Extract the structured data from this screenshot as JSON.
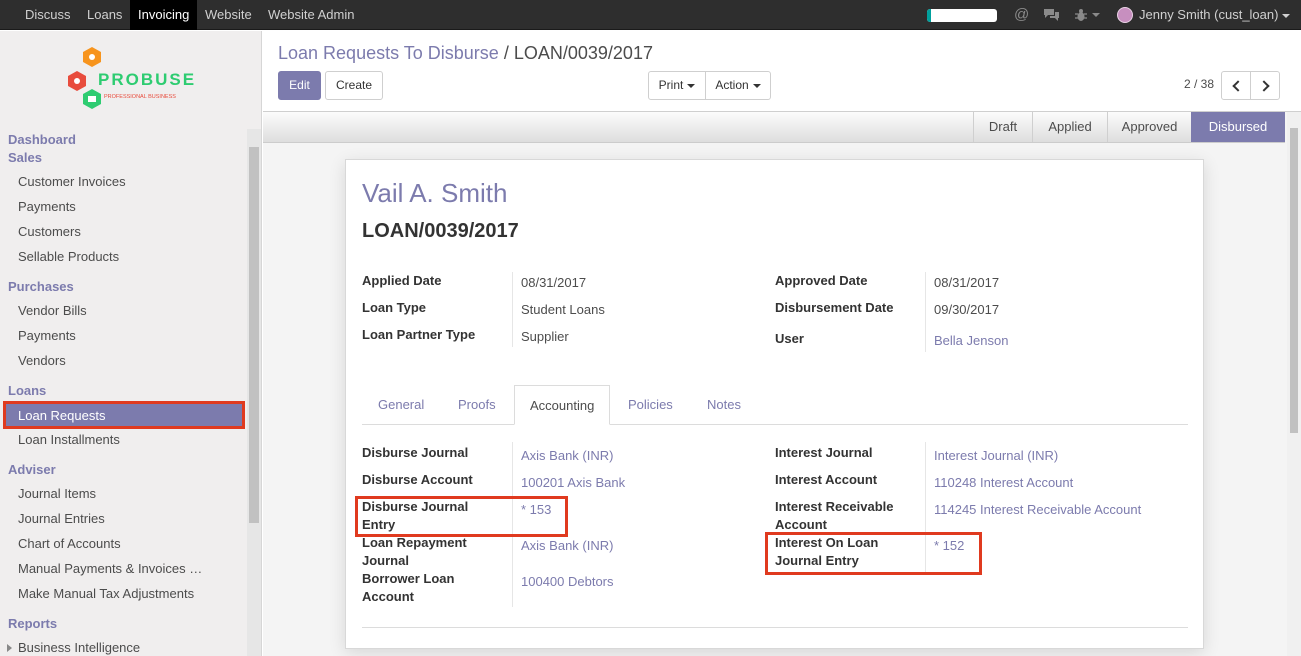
{
  "topbar": {
    "menus": [
      "Discuss",
      "Loans",
      "Invoicing",
      "Website",
      "Website Admin"
    ],
    "active_menu": "Invoicing",
    "progress_fraction": 0.05,
    "user_name": "Jenny Smith (cust_loan)",
    "icons": [
      "at-icon",
      "chat-icon",
      "bug-icon"
    ]
  },
  "logo": {
    "brand": "PROBUSE",
    "tagline": "PROFESSIONAL BUSINESS"
  },
  "sidebar": {
    "dashboard": "Dashboard",
    "sales": "Sales",
    "customer_invoices": "Customer Invoices",
    "payments": "Payments",
    "customers": "Customers",
    "sellable_products": "Sellable Products",
    "purchases": "Purchases",
    "vendor_bills": "Vendor Bills",
    "payments2": "Payments",
    "vendors": "Vendors",
    "loans": "Loans",
    "loan_requests": "Loan Requests",
    "loan_installments": "Loan Installments",
    "adviser": "Adviser",
    "journal_items": "Journal Items",
    "journal_entries": "Journal Entries",
    "chart_of_accounts": "Chart of Accounts",
    "manual_payments": "Manual Payments & Invoices …",
    "manual_tax": "Make Manual Tax Adjustments",
    "reports": "Reports",
    "business_intelligence": "Business Intelligence"
  },
  "breadcrumb": {
    "parent": "Loan Requests To Disburse",
    "separator": "/",
    "current": "LOAN/0039/2017"
  },
  "buttons": {
    "edit": "Edit",
    "create": "Create",
    "print": "Print",
    "action": "Action"
  },
  "pager": {
    "value": "2 / 38"
  },
  "statusbar": {
    "stages": [
      "Draft",
      "Applied",
      "Approved",
      "Disbursed"
    ],
    "active": "Disbursed"
  },
  "record": {
    "partner": "Vail A. Smith",
    "name": "LOAN/0039/2017",
    "applied_date_label": "Applied Date",
    "applied_date": "08/31/2017",
    "loan_type_label": "Loan Type",
    "loan_type": "Student Loans",
    "partner_type_label": "Loan Partner Type",
    "partner_type": "Supplier",
    "approved_date_label": "Approved Date",
    "approved_date": "08/31/2017",
    "disbursement_date_label": "Disbursement Date",
    "disbursement_date": "09/30/2017",
    "user_label": "User",
    "user": "Bella Jenson"
  },
  "tabs": [
    "General",
    "Proofs",
    "Accounting",
    "Policies",
    "Notes"
  ],
  "active_tab": "Accounting",
  "accounting": {
    "disburse_journal_label": "Disburse Journal",
    "disburse_journal": "Axis Bank (INR)",
    "disburse_account_label": "Disburse Account",
    "disburse_account": "100201 Axis Bank",
    "disburse_entry_label_1": "Disburse Journal",
    "disburse_entry_label_2": "Entry",
    "disburse_entry": "* 153",
    "repayment_journal_label_1": "Loan Repayment",
    "repayment_journal_label_2": "Journal",
    "repayment_journal": "Axis Bank (INR)",
    "borrower_account_label_1": "Borrower Loan",
    "borrower_account_label_2": "Account",
    "borrower_account": "100400 Debtors",
    "interest_journal_label": "Interest Journal",
    "interest_journal": "Interest Journal (INR)",
    "interest_account_label": "Interest Account",
    "interest_account": "110248 Interest Account",
    "interest_receivable_label_1": "Interest Receivable",
    "interest_receivable_label_2": "Account",
    "interest_receivable": "114245 Interest Receivable Account",
    "interest_entry_label_1": "Interest On Loan",
    "interest_entry_label_2": "Journal Entry",
    "interest_entry": "* 152"
  },
  "colors": {
    "accent": "#7c7bad",
    "highlight": "#e03a1f",
    "navbar": "#2e2e2e"
  }
}
